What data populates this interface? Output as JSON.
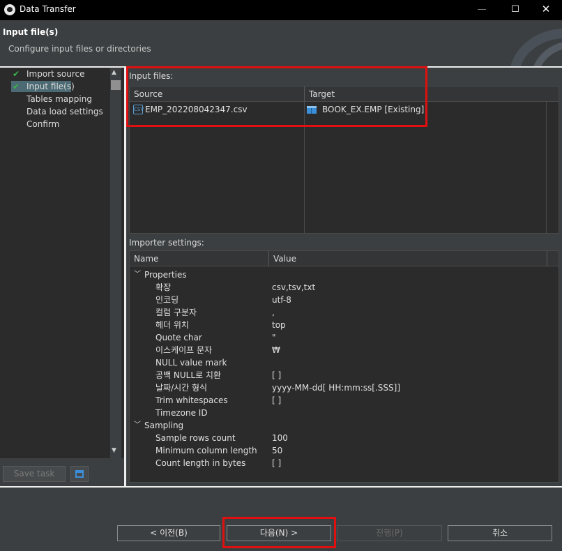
{
  "window": {
    "title": "Data Transfer",
    "minimize": "—",
    "maximize": "☐",
    "close": "✕"
  },
  "header": {
    "title": "Input file(s)",
    "description": "Configure input files or directories"
  },
  "nav": {
    "items": [
      {
        "label": "Import source",
        "done": true
      },
      {
        "label": "Input file(s)",
        "done": true,
        "selected": true
      },
      {
        "label": "Tables mapping",
        "done": false
      },
      {
        "label": "Data load settings",
        "done": false
      },
      {
        "label": "Confirm",
        "done": false
      }
    ],
    "save_task": "Save task"
  },
  "input_files": {
    "label": "Input files:",
    "columns": [
      "Source",
      "Target"
    ],
    "rows": [
      {
        "source": "EMP_202208042347.csv",
        "target": "BOOK_EX.EMP [Existing]"
      }
    ],
    "csv_icon_text": "CSV"
  },
  "importer": {
    "label": "Importer settings:",
    "columns": [
      "Name",
      "Value"
    ],
    "groups": [
      {
        "name": "Properties",
        "props": [
          {
            "name": "확장",
            "value": "csv,tsv,txt"
          },
          {
            "name": "인코딩",
            "value": "utf-8"
          },
          {
            "name": "컬럼 구분자",
            "value": ","
          },
          {
            "name": "헤더 위치",
            "value": "top"
          },
          {
            "name": "Quote char",
            "value": "\""
          },
          {
            "name": "이스케이프 문자",
            "value": "₩"
          },
          {
            "name": "NULL value mark",
            "value": ""
          },
          {
            "name": "공백 NULL로 치환",
            "value": "[ ]"
          },
          {
            "name": "날짜/시간 형식",
            "value": "yyyy-MM-dd[ HH:mm:ss[.SSS]]"
          },
          {
            "name": "Trim whitespaces",
            "value": "[ ]"
          },
          {
            "name": "Timezone ID",
            "value": ""
          }
        ]
      },
      {
        "name": "Sampling",
        "props": [
          {
            "name": "Sample rows count",
            "value": "100"
          },
          {
            "name": "Minimum column length",
            "value": "50"
          },
          {
            "name": "Count length in bytes",
            "value": "[ ]"
          }
        ]
      }
    ]
  },
  "buttons": {
    "prev": "< 이전(B)",
    "next": "다음(N) >",
    "run": "진행(P)",
    "cancel": "취소"
  },
  "colors": {
    "check": "#39b54a",
    "highlight": "#e01010",
    "selected": "#4b6a73"
  }
}
